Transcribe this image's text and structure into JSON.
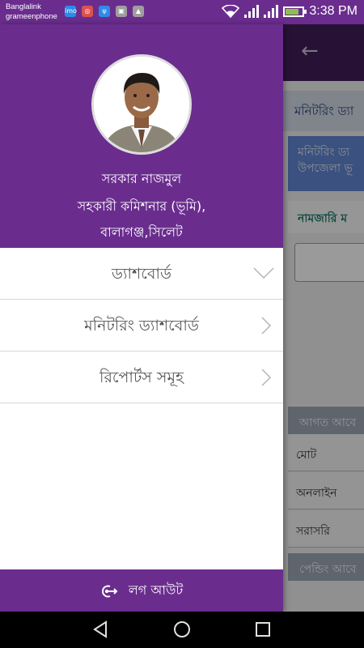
{
  "status_bar": {
    "carrier_primary": "Banglalink",
    "carrier_secondary": "grameenphone",
    "time": "3:38 PM",
    "notification_icons": [
      "imo-icon",
      "instagram-icon",
      "usb-icon",
      "image-icon",
      "warning-icon"
    ]
  },
  "drawer": {
    "profile": {
      "name": "সরকার নাজমুল",
      "designation": "সহকারী কমিশনার (ভূমি),",
      "location": "বালাগঞ্জ,সিলেট"
    },
    "menu": [
      {
        "label": "ড্যাশবোর্ড",
        "chevron": "chevron-down-icon"
      },
      {
        "label": "মনিটরিং ড্যাশবোর্ড",
        "chevron": "chevron-right-icon"
      },
      {
        "label": "রিপোর্টস সমূহ",
        "chevron": "chevron-right-icon"
      }
    ],
    "logout_label": "লগ আউট"
  },
  "background": {
    "row1": "মনিটরিং ড্যা",
    "row2_line1": "মনিটরিং ড্য",
    "row2_line2": "উপজেলা ভূ",
    "row3": "নামজারি ম",
    "section1": "আগত আবে",
    "cells": [
      "মোট",
      "অনলাইন",
      "সরাসরি"
    ],
    "section2": "পেন্ডিং আবে"
  },
  "colors": {
    "primary": "#6a2d8e",
    "toolbar_dark": "#3f1c56"
  }
}
